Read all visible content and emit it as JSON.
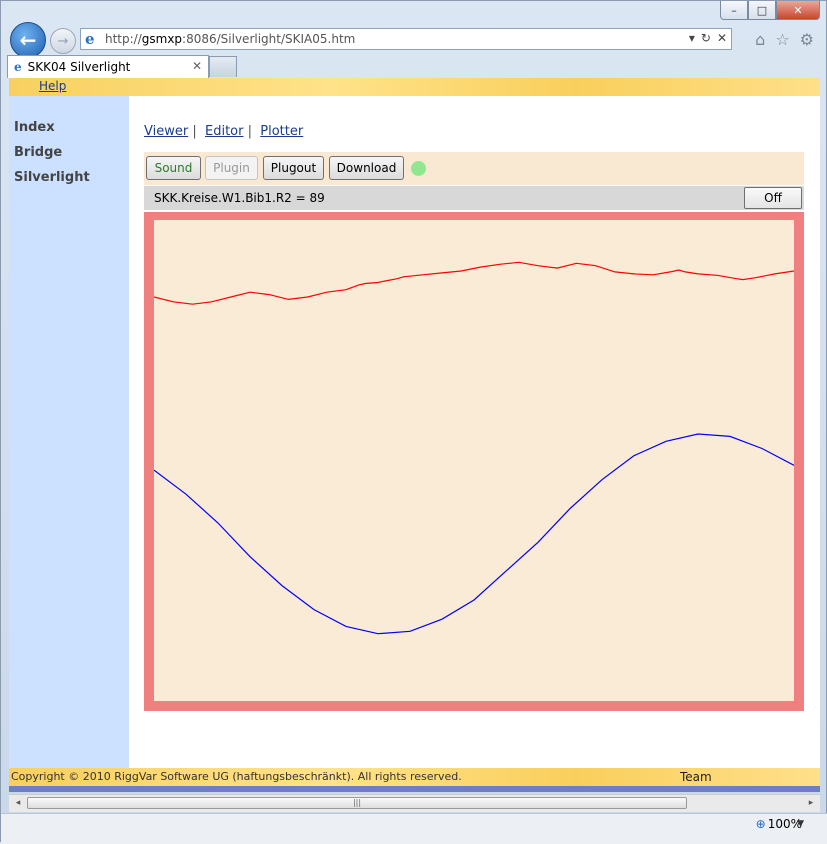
{
  "window": {
    "minimize_label": "–",
    "maximize_label": "□",
    "close_label": "✕"
  },
  "nav": {
    "back_glyph": "←",
    "forward_glyph": "→",
    "address_prefix": "http://",
    "address_host": "gsmxp",
    "address_rest": ":8086/Silverlight/SKIA05.htm",
    "address_tools": [
      "▾",
      "↻",
      "✕"
    ],
    "toolbar_icons": [
      "⌂",
      "☆",
      "⚙"
    ]
  },
  "tab": {
    "title": "SKK04 Silverlight",
    "close": "✕"
  },
  "menu": {
    "help": "Help"
  },
  "sidebar": {
    "items": [
      "Index",
      "Bridge",
      "Silverlight"
    ]
  },
  "links": {
    "viewer": "Viewer",
    "editor": "Editor",
    "plotter": "Plotter",
    "separator": "|"
  },
  "toolbar": {
    "sound": "Sound",
    "plugin": "Plugin",
    "plugout": "Plugout",
    "download": "Download",
    "status_led_color": "#8fe88f"
  },
  "status": {
    "text": "SKK.Kreise.W1.Bib1.R2 = 89",
    "off_button": "Off"
  },
  "chart_data": {
    "type": "line",
    "title": "",
    "xlabel": "",
    "ylabel": "",
    "xlim": [
      0,
      100
    ],
    "ylim": [
      0,
      100
    ],
    "grid": false,
    "series": [
      {
        "color": "#ff0000",
        "x": [
          0,
          3,
          6,
          9,
          12,
          15,
          18,
          21,
          24,
          27,
          30,
          32,
          33,
          35,
          36,
          38,
          39,
          42,
          45,
          48,
          51,
          54,
          57,
          60,
          63,
          66,
          69,
          72,
          75,
          78,
          81,
          82,
          83,
          85,
          88,
          91,
          92,
          94,
          97,
          100
        ],
        "y": [
          84,
          83,
          82.5,
          83,
          84,
          85,
          84.5,
          83.5,
          84,
          85,
          85.5,
          86.5,
          86.8,
          87,
          87.3,
          87.8,
          88.2,
          88.6,
          89,
          89.4,
          90.2,
          90.8,
          91.2,
          90.5,
          90,
          91,
          90.5,
          89.2,
          88.8,
          88.6,
          89.3,
          89.6,
          89.2,
          88.8,
          88.5,
          87.8,
          87.6,
          88,
          88.8,
          89.4
        ]
      },
      {
        "color": "#0000ff",
        "x": [
          0,
          5,
          10,
          15,
          20,
          25,
          30,
          35,
          40,
          45,
          50,
          55,
          60,
          65,
          70,
          75,
          80,
          85,
          90,
          95,
          100
        ],
        "y": [
          48,
          43,
          37,
          30,
          24,
          19,
          15.5,
          14,
          14.5,
          17,
          21,
          27,
          33,
          40,
          46,
          51,
          54,
          55.5,
          55,
          52.5,
          49
        ]
      }
    ]
  },
  "footer": {
    "copyright": "Copyright © 2010 RiggVar Software UG (haftungsbeschränkt). All rights reserved.",
    "team": "Team"
  },
  "scroll": {
    "left_arrow": "◂",
    "right_arrow": "▸",
    "grip": "|||"
  },
  "statusbar": {
    "zoom": "100%",
    "zoom_icon": "⊕",
    "dropdown": "▼"
  }
}
